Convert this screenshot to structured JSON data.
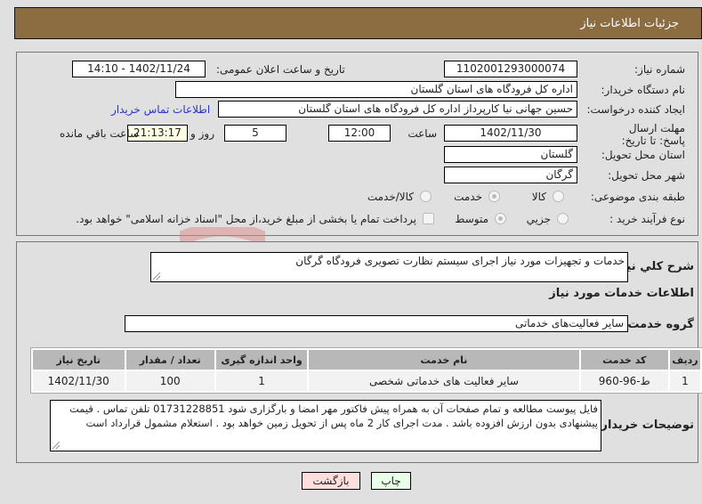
{
  "header": {
    "title": "جزئیات اطلاعات نیاز"
  },
  "need_info": {
    "need_number_label": "شماره نیاز:",
    "need_number": "1102001293000074",
    "announce_label": "تاریخ و ساعت اعلان عمومی:",
    "announce_value": "1402/11/24 - 14:10",
    "buyer_org_label": "نام دستگاه خریدار:",
    "buyer_org": "اداره کل فرودگاه های استان گلستان",
    "creator_label": "ایجاد کننده درخواست:",
    "creator": "حسین  جهانی نیا کارپرداز اداره کل فرودگاه های استان گلستان",
    "contact_link": "اطلاعات تماس خریدار",
    "deadline_label": "مهلت ارسال پاسخ: تا تاریخ:",
    "deadline_date": "1402/11/30",
    "time_label": "ساعت",
    "deadline_time": "12:00",
    "days_value": "5",
    "days_label": "روز و",
    "remaining_time": "21:13:17",
    "remaining_label": "ساعت باقي مانده",
    "province_label": "استان محل تحویل:",
    "province": "گلستان",
    "city_label": "شهر محل تحویل:",
    "city": "گرگان",
    "category_label": "طبقه بندی موضوعی:",
    "category_options": [
      "کالا",
      "خدمت",
      "کالا/خدمت"
    ],
    "category_selected": "خدمت",
    "process_label": "نوع فرآیند خرید :",
    "process_options": [
      "جزیي",
      "متوسط"
    ],
    "process_selected": "متوسط",
    "payment_checkbox_label": "پرداخت تمام یا بخشی از مبلغ خرید،از محل \"اسناد خزانه اسلامی\" خواهد بود.",
    "payment_checked": false
  },
  "details": {
    "summary_label": "شرح كلي نياز:",
    "summary": "خدمات و تجهیزات مورد نیاز اجرای سیستم نظارت تصویری فرودگاه گرگان",
    "services_heading": "اطلاعات خدمات مورد نیاز",
    "service_group_label": "گروه خدمت:",
    "service_group": "سایر فعالیت‌های خدماتی",
    "table": {
      "headers": [
        "ردیف",
        "کد خدمت",
        "نام خدمت",
        "واحد اندازه گیری",
        "تعداد / مقدار",
        "تاریخ نیاز"
      ],
      "rows": [
        [
          "1",
          "ط-96-960",
          "سایر فعالیت های خدماتی شخصی",
          "1",
          "100",
          "1402/11/30"
        ]
      ]
    },
    "buyer_notes_label": "توضیحات خریدار:",
    "buyer_notes": "فایل پیوست مطالعه و تمام صفحات آن به همراه پیش فاکتور مهر امضا و بارگزاری شود 01731228851 تلفن تماس . قیمت پیشنهادی بدون ارزش افزوده باشد . مدت اجرای کار 2 ماه پس از تحویل زمین خواهد بود . استعلام مشمول قرارداد است"
  },
  "buttons": {
    "print": "چاپ",
    "back": "بازگشت"
  },
  "colors": {
    "header_bg": "#8c6d42",
    "print_bg": "#eaffea",
    "back_bg": "#ffdede",
    "link": "#2b35c8"
  }
}
